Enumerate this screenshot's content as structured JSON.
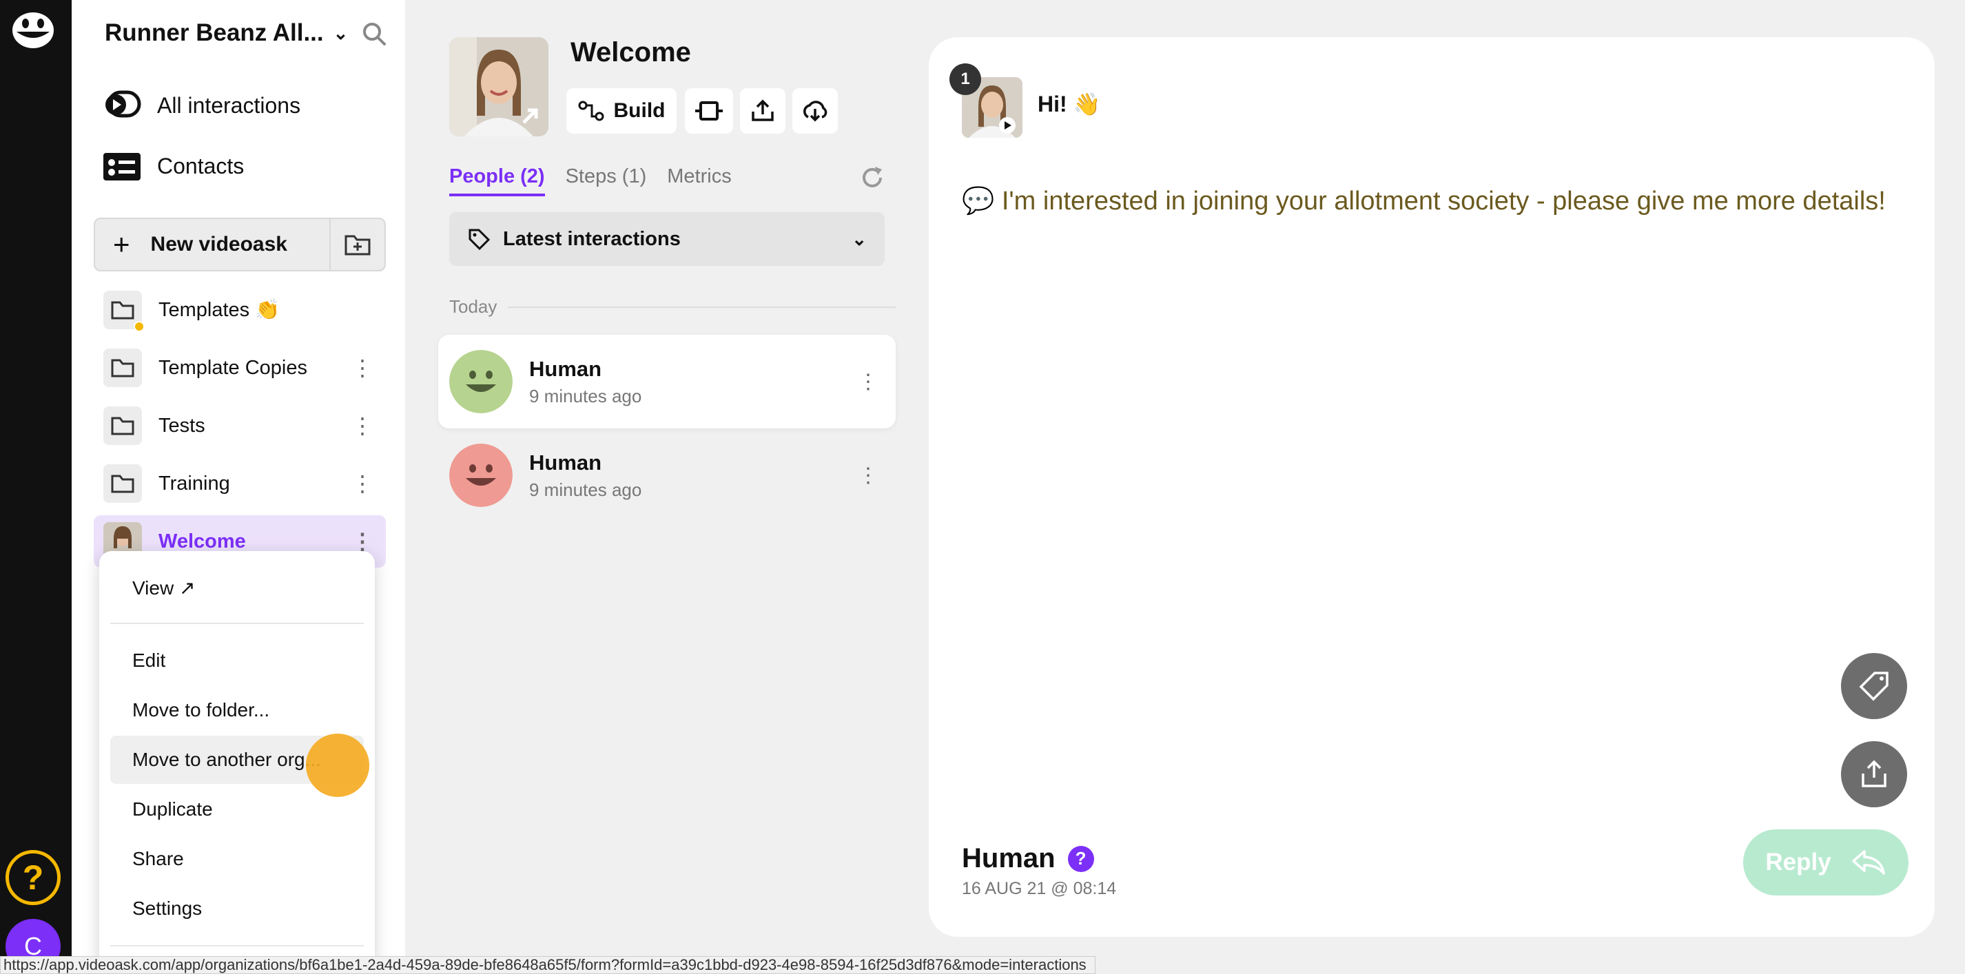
{
  "org": {
    "name": "Runner Beanz All..."
  },
  "nav": {
    "all_interactions": "All interactions",
    "contacts": "Contacts",
    "new_videoask": "New videoask"
  },
  "folders": [
    {
      "label": "Templates 👏"
    },
    {
      "label": "Template Copies"
    },
    {
      "label": "Tests"
    },
    {
      "label": "Training"
    },
    {
      "label": "Welcome"
    }
  ],
  "menu": {
    "view": "View ↗",
    "edit": "Edit",
    "move_folder": "Move to folder...",
    "move_org": "Move to another org...",
    "duplicate": "Duplicate",
    "share": "Share",
    "settings": "Settings"
  },
  "videoask": {
    "title": "Welcome",
    "build_label": "Build",
    "tabs": [
      "People (2)",
      "Steps (1)",
      "Metrics"
    ],
    "filter": "Latest interactions",
    "section": "Today",
    "people": [
      {
        "name": "Human",
        "time": "9 minutes ago",
        "color": "#b6d38f"
      },
      {
        "name": "Human",
        "time": "9 minutes ago",
        "color": "#ef9a92"
      }
    ]
  },
  "detail": {
    "step_number": "1",
    "step_question": "Hi! 👋",
    "message": "💬 I'm interested in joining your allotment society - please give me more details!",
    "person_name": "Human",
    "help_mark": "?",
    "date": "16 AUG 21 @ 08:14",
    "reply_label": "Reply"
  },
  "rail": {
    "help": "?",
    "user_initial": "C"
  },
  "status_url": "https://app.videoask.com/app/organizations/bf6a1be1-2a4d-459a-89de-bfe8648a65f5/form?formId=a39c1bbd-d923-4e98-8594-16f25d3df876&mode=interactions",
  "colors": {
    "accent": "#7b2ff7",
    "reply": "#b8ead0",
    "highlight": "#f5aa1e"
  }
}
